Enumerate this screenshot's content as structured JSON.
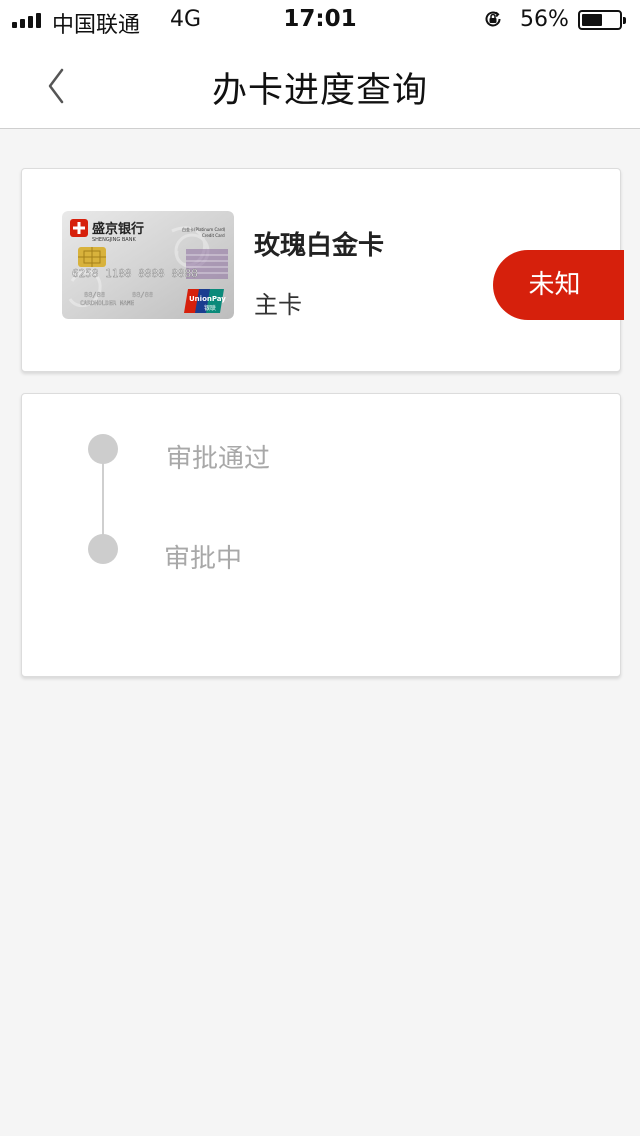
{
  "status_bar": {
    "carrier": "中国联通",
    "network": "4G",
    "time": "17:01",
    "battery_percent": "56%",
    "battery_level": 0.56,
    "icons": [
      "signal-icon",
      "orientation-lock-icon",
      "battery-icon"
    ]
  },
  "nav": {
    "title": "办卡进度查询",
    "back_icon": "chevron-left-icon"
  },
  "card": {
    "name": "玫瑰白金卡",
    "type": "主卡",
    "status": "未知",
    "image": {
      "bank_name": "盛京银行",
      "bank_name_en": "SHENGJING BANK",
      "card_tier": "白金卡(Platinum Card)",
      "card_kind": "Credit Card",
      "card_number": "6258 1188 8888 8888",
      "expiry_a": "88/88",
      "expiry_b": "88/88",
      "holder": "CARDHOLDER NAME",
      "network_en": "UnionPay",
      "network_cn": "银联"
    }
  },
  "progress": {
    "steps": [
      {
        "label": "审批通过"
      },
      {
        "label": "审批中"
      }
    ]
  },
  "colors": {
    "accent": "#d6200c",
    "background": "#f5f5f5",
    "step_dot": "#cdcdcd",
    "step_text": "#a8a8a8"
  }
}
